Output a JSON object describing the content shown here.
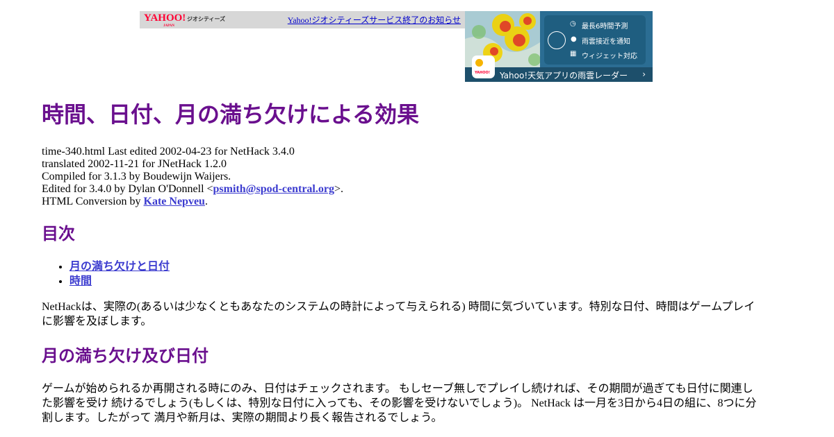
{
  "banner": {
    "logo_text": "YAHOO!",
    "logo_sub": "JAPAN",
    "service_name": "ジオシティーズ",
    "notice_link": "Yahoo!ジオシティーズサービス終了のお知らせ"
  },
  "ad": {
    "features": [
      {
        "icon": "clock-icon",
        "label": "最長6時間予測"
      },
      {
        "icon": "location-pin-icon",
        "label": "雨雲接近を通知"
      },
      {
        "icon": "widget-icon",
        "label": "ウィジェット対応"
      }
    ],
    "app_icon_label": "YAHOO!",
    "footer_text": "Yahoo!天気アプリの雨雲レーダー",
    "colors": {
      "panel": "#1f5e80",
      "footer": "#1d4f6b"
    }
  },
  "page": {
    "title": "時間、日付、月の満ち欠けによる効果",
    "meta": {
      "line1": "time-340.html Last edited 2002-04-23 for NetHack 3.4.0",
      "line2": "translated 2002-11-21 for JNetHack 1.2.0",
      "line3": "Compiled for 3.1.3 by Boudewijn Waijers.",
      "line4_prefix": "Edited for 3.4.0 by Dylan O'Donnell <",
      "line4_email": "psmith@spod-central.org",
      "line4_suffix": ">.",
      "line5_prefix": "HTML Conversion by ",
      "line5_link": "Kate Nepveu",
      "line5_suffix": "."
    },
    "toc_heading": "目次",
    "toc_items": [
      "月の満ち欠けと日付",
      "時間"
    ],
    "intro": "NetHackは、実際の(あるいは少なくともあなたのシステムの時計によって与えられる) 時間に気づいています。特別な日付、時間はゲームプレイに影響を及ぼします。",
    "section_heading": "月の満ち欠け及び日付",
    "section_text": "ゲームが始められるか再開される時にのみ、日付はチェックされます。 もしセーブ無しでプレイし続ければ、その期間が過ぎても日付に関連した影響を受け 続けるでしょう(もしくは、特別な日付に入っても、その影響を受けないでしょう)。 NetHack は一月を3日から4日の組に、8つに分割します。したがって 満月や新月は、実際の期間より長く報告されるでしょう。",
    "colors": {
      "heading": "#6a0f8e",
      "link": "#3b3bcf"
    }
  }
}
